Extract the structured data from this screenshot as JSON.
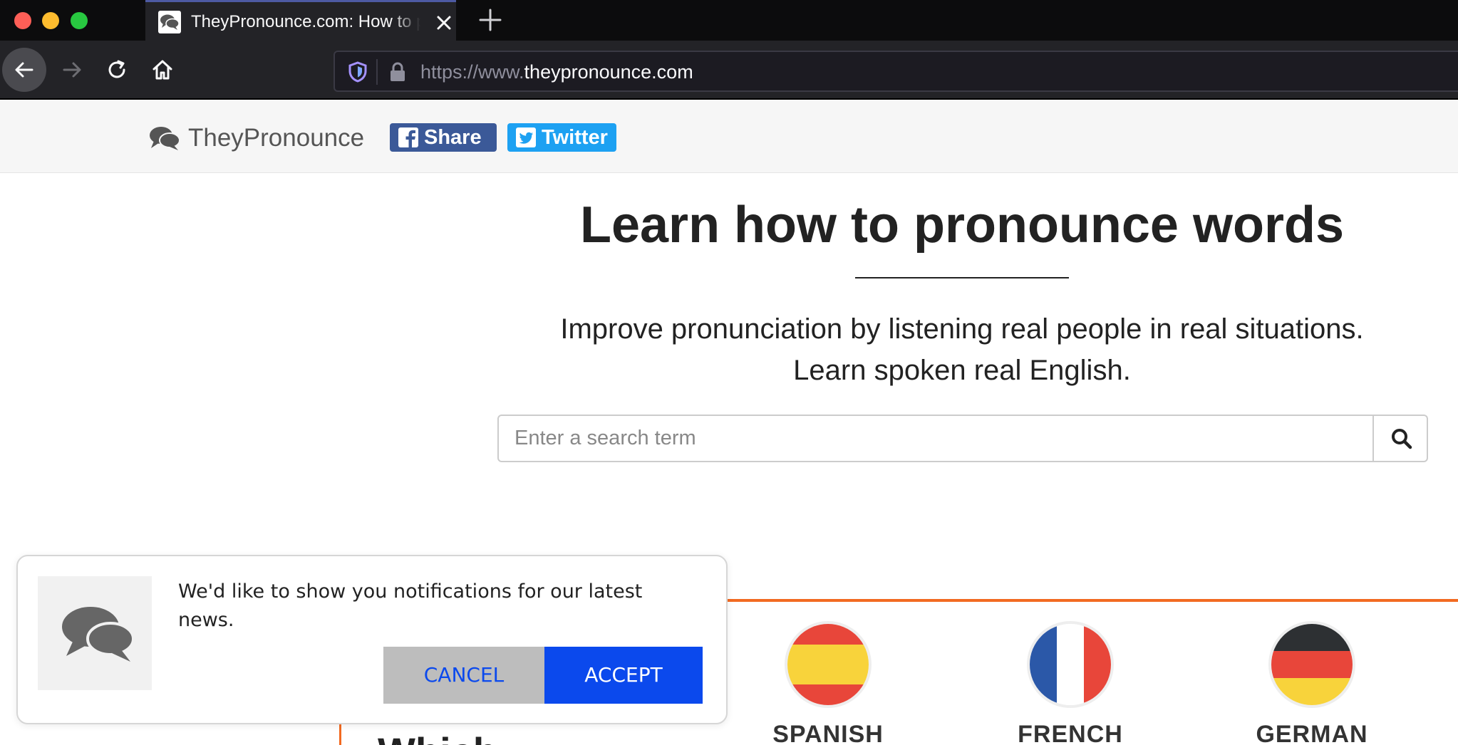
{
  "browser": {
    "tab_title": "TheyPronounce.com: How to pronounce",
    "url_prefix": "https://www.",
    "url_domain": "theypronounce.com"
  },
  "header": {
    "brand_name": "TheyPronounce",
    "share_label": "Share",
    "twitter_label": "Twitter"
  },
  "hero": {
    "title": "Learn how to pronounce words",
    "subtitle_line1": "Improve pronunciation by listening real people in real situations.",
    "subtitle_line2": "Learn spoken real English."
  },
  "search": {
    "placeholder": "Enter a search term"
  },
  "section": {
    "heading": "Which"
  },
  "languages": [
    {
      "label": "SPANISH",
      "flag_colors": [
        "#e8463a",
        "#f8d33b",
        "#e8463a"
      ]
    },
    {
      "label": "FRENCH",
      "flag_colors": [
        "#2b58a8",
        "#ffffff",
        "#e8463a"
      ]
    },
    {
      "label": "GERMAN",
      "flag_colors": [
        "#2d3033",
        "#e8463a",
        "#f8d33b"
      ]
    }
  ],
  "notification": {
    "message": "We'd like to show you notifications for our latest news.",
    "cancel_label": "CANCEL",
    "accept_label": "ACCEPT"
  },
  "colors": {
    "accent_orange": "#f26a21",
    "facebook_blue": "#3b5998",
    "twitter_blue": "#1da1f2",
    "accept_blue": "#0b49ed"
  }
}
